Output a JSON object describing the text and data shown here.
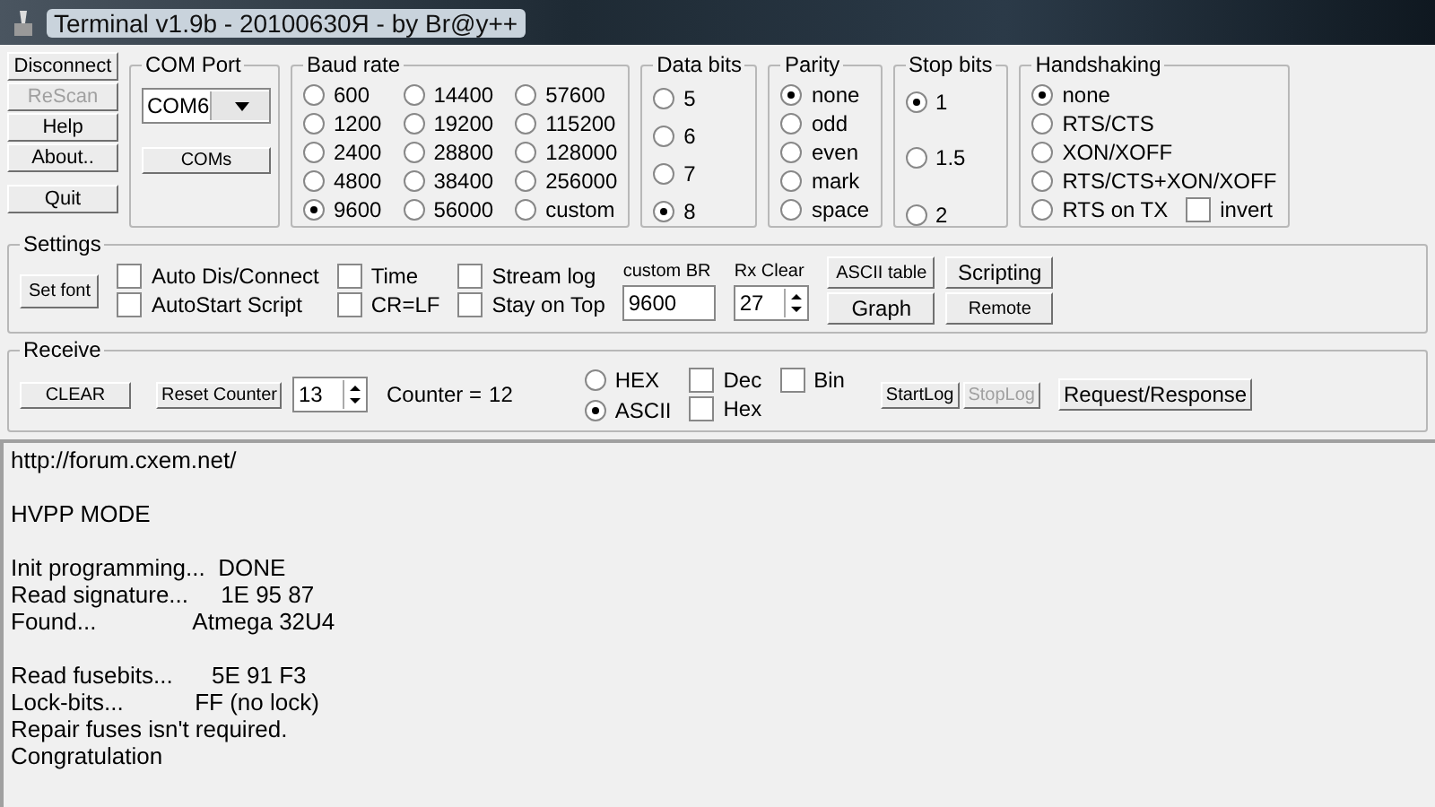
{
  "window": {
    "title": "Terminal v1.9b - 20100630Я - by Br@y++"
  },
  "side_buttons": [
    {
      "label": "Disconnect",
      "disabled": false
    },
    {
      "label": "ReScan",
      "disabled": true
    },
    {
      "label": "Help",
      "disabled": false
    },
    {
      "label": "About..",
      "disabled": false
    },
    {
      "label": "Quit",
      "disabled": false
    }
  ],
  "com_port": {
    "title": "COM Port",
    "value": "COM6",
    "button": "COMs"
  },
  "baud_rate": {
    "title": "Baud rate",
    "options": [
      {
        "label": "600",
        "selected": false
      },
      {
        "label": "14400",
        "selected": false
      },
      {
        "label": "57600",
        "selected": false
      },
      {
        "label": "1200",
        "selected": false
      },
      {
        "label": "19200",
        "selected": false
      },
      {
        "label": "115200",
        "selected": false
      },
      {
        "label": "2400",
        "selected": false
      },
      {
        "label": "28800",
        "selected": false
      },
      {
        "label": "128000",
        "selected": false
      },
      {
        "label": "4800",
        "selected": false
      },
      {
        "label": "38400",
        "selected": false
      },
      {
        "label": "256000",
        "selected": false
      },
      {
        "label": "9600",
        "selected": true
      },
      {
        "label": "56000",
        "selected": false
      },
      {
        "label": "custom",
        "selected": false
      }
    ]
  },
  "data_bits": {
    "title": "Data bits",
    "options": [
      {
        "label": "5",
        "selected": false
      },
      {
        "label": "6",
        "selected": false
      },
      {
        "label": "7",
        "selected": false
      },
      {
        "label": "8",
        "selected": true
      }
    ]
  },
  "parity": {
    "title": "Parity",
    "options": [
      {
        "label": "none",
        "selected": true
      },
      {
        "label": "odd",
        "selected": false
      },
      {
        "label": "even",
        "selected": false
      },
      {
        "label": "mark",
        "selected": false
      },
      {
        "label": "space",
        "selected": false
      }
    ]
  },
  "stop_bits": {
    "title": "Stop bits",
    "options": [
      {
        "label": "1",
        "selected": true
      },
      {
        "label": "1.5",
        "selected": false
      },
      {
        "label": "2",
        "selected": false
      }
    ]
  },
  "handshaking": {
    "title": "Handshaking",
    "options": [
      {
        "label": "none",
        "selected": true
      },
      {
        "label": "RTS/CTS",
        "selected": false
      },
      {
        "label": "XON/XOFF",
        "selected": false
      },
      {
        "label": "RTS/CTS+XON/XOFF",
        "selected": false
      },
      {
        "label": "RTS on TX",
        "selected": false
      }
    ],
    "invert": {
      "label": "invert",
      "checked": false
    }
  },
  "settings": {
    "title": "Settings",
    "set_font": "Set font",
    "checkboxes": [
      {
        "label": "Auto Dis/Connect",
        "checked": false
      },
      {
        "label": "AutoStart Script",
        "checked": false
      },
      {
        "label": "Time",
        "checked": false
      },
      {
        "label": "CR=LF",
        "checked": false
      },
      {
        "label": "Stream log",
        "checked": false
      },
      {
        "label": "Stay on Top",
        "checked": false
      }
    ],
    "custom_br": {
      "label": "custom BR",
      "value": "9600"
    },
    "rx_clear": {
      "label": "Rx Clear",
      "value": "27"
    },
    "buttons": [
      {
        "label": "ASCII table",
        "kind": "small"
      },
      {
        "label": "Scripting",
        "kind": "large"
      },
      {
        "label": "Graph",
        "kind": "large"
      },
      {
        "label": "Remote",
        "kind": "small"
      }
    ]
  },
  "receive": {
    "title": "Receive",
    "clear": "CLEAR",
    "reset_counter": "Reset Counter",
    "counter_value": "13",
    "counter_label": "Counter =",
    "counter": "12",
    "format": [
      {
        "label": "HEX",
        "selected": false
      },
      {
        "label": "ASCII",
        "selected": true
      }
    ],
    "checkboxes": [
      {
        "label": "Dec",
        "checked": false
      },
      {
        "label": "Bin",
        "checked": false
      },
      {
        "label": "Hex",
        "checked": false
      }
    ],
    "start_log": {
      "label": "StartLog",
      "disabled": false
    },
    "stop_log": {
      "label": "StopLog",
      "disabled": true
    },
    "request": "Request/Response"
  },
  "output": {
    "blocks": [
      [
        "http://forum.cxem.net/"
      ],
      [
        "HVPP MODE"
      ],
      [
        "Init programming...  DONE",
        "Read signature...     1E 95 87",
        "Found...               Atmega 32U4"
      ],
      [
        "Read fusebits...      5E 91 F3",
        "Lock-bits...           FF (no lock)",
        "Repair fuses isn't required.",
        "Congratulation"
      ]
    ]
  }
}
